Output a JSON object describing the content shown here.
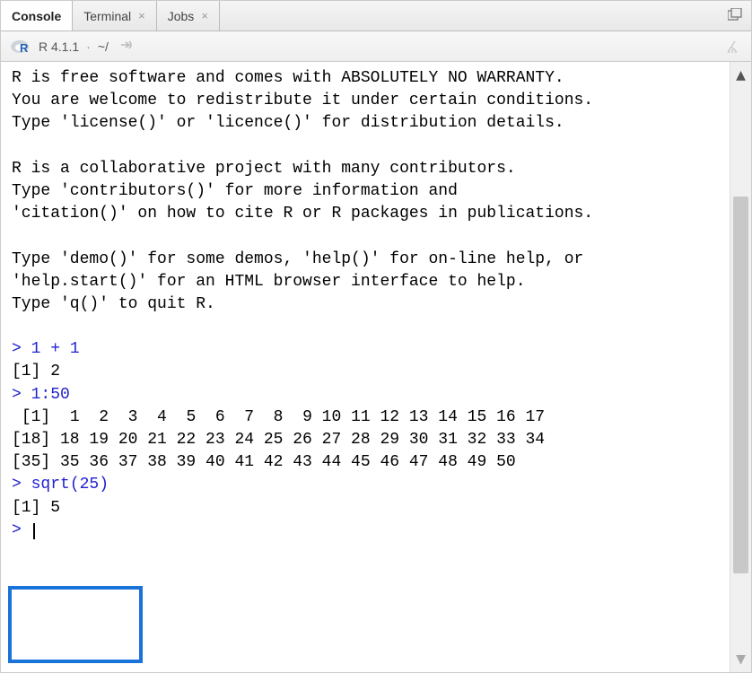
{
  "tabs": {
    "console": "Console",
    "terminal": "Terminal",
    "jobs": "Jobs"
  },
  "toolbar": {
    "version": "R 4.1.1",
    "dot": "·",
    "path": "~/"
  },
  "console": {
    "line1": "R is free software and comes with ABSOLUTELY NO WARRANTY.",
    "line2": "You are welcome to redistribute it under certain conditions.",
    "line3": "Type 'license()' or 'licence()' for distribution details.",
    "line4": "",
    "line5": "R is a collaborative project with many contributors.",
    "line6": "Type 'contributors()' for more information and",
    "line7": "'citation()' on how to cite R or R packages in publications.",
    "line8": "",
    "line9": "Type 'demo()' for some demos, 'help()' for on-line help, or",
    "line10": "'help.start()' for an HTML browser interface to help.",
    "line11": "Type 'q()' to quit R.",
    "line12": "",
    "p1": "> ",
    "cmd1": "1 + 1",
    "out1": "[1] 2",
    "p2": "> ",
    "cmd2": "1:50",
    "seq1": " [1]  1  2  3  4  5  6  7  8  9 10 11 12 13 14 15 16 17",
    "seq2": "[18] 18 19 20 21 22 23 24 25 26 27 28 29 30 31 32 33 34",
    "seq3": "[35] 35 36 37 38 39 40 41 42 43 44 45 46 47 48 49 50",
    "p3": "> ",
    "cmd3": "sqrt(25)",
    "out3": "[1] 5",
    "p4": "> "
  }
}
